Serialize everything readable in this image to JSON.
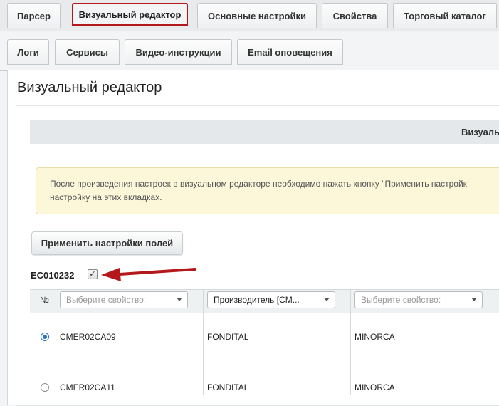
{
  "tabs_row1": [
    {
      "label": "Парсер",
      "active": false
    },
    {
      "label": "Визуальный редактор",
      "active": true
    },
    {
      "label": "Основные настройки",
      "active": false
    },
    {
      "label": "Свойства",
      "active": false
    },
    {
      "label": "Торговый каталог",
      "active": false
    }
  ],
  "tabs_row2": [
    {
      "label": "Логи"
    },
    {
      "label": "Сервисы"
    },
    {
      "label": "Видео-инструкции"
    },
    {
      "label": "Email оповещения"
    }
  ],
  "page_title": "Визуальный редактор",
  "section_header": "Визуаль",
  "notice": {
    "line1": "После произведения настроек в визуальном редакторе необходимо нажать кнопку \"Применить настройк",
    "line2": "настройку на этих вкладках."
  },
  "apply_button": "Применить настройки полей",
  "record": {
    "code": "EC010232",
    "checked": true
  },
  "table": {
    "number_header": "№",
    "selects": [
      {
        "value": "Выберите свойство:",
        "placeholder": true
      },
      {
        "value": "Производитель [CM...",
        "placeholder": false
      },
      {
        "value": "Выберите свойство:",
        "placeholder": true
      }
    ],
    "rows": [
      {
        "selected": true,
        "col1": "CMER02CA09",
        "col2": "FONDITAL",
        "col3": "MINORCA"
      },
      {
        "selected": false,
        "col1": "CMER02CA11",
        "col2": "FONDITAL",
        "col3": "MINORCA"
      }
    ]
  },
  "colors": {
    "active_tab_border": "#b3191a",
    "arrow": "#b3191a",
    "notice_bg": "#fdf7d9",
    "radio_accent": "#2277cc"
  }
}
